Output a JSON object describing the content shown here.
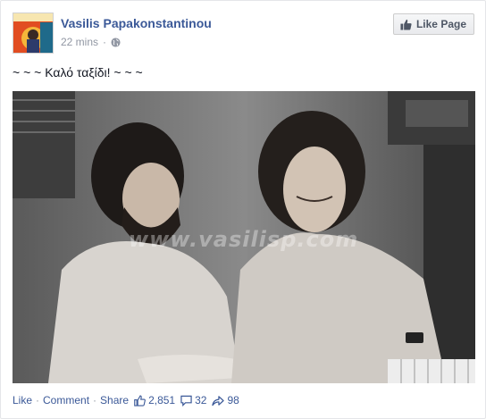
{
  "post": {
    "author": "Vasilis Papakonstantinou",
    "timestamp": "22 mins",
    "text": "~ ~ ~ Καλό ταξίδι! ~ ~ ~",
    "like_page_label": "Like Page",
    "photo_watermark": "www.vasilisp.com"
  },
  "actions": {
    "like": "Like",
    "comment": "Comment",
    "share": "Share",
    "separator": "·"
  },
  "stats": {
    "likes": "2,851",
    "comments": "32",
    "shares": "98"
  },
  "icons": {
    "privacy": "globe-icon",
    "like_page": "thumbs-up-icon",
    "likes": "thumbs-up-icon",
    "comments": "speech-bubble-icon",
    "shares": "share-arrow-icon"
  },
  "colors": {
    "link": "#3b5998",
    "meta": "#9197a3",
    "text": "#141823"
  }
}
